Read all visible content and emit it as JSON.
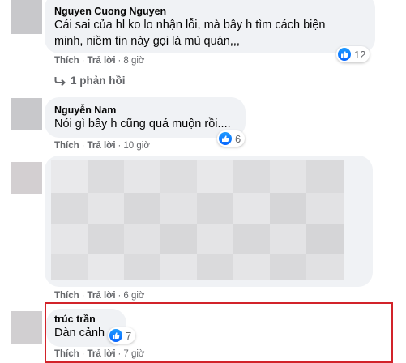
{
  "comments": [
    {
      "author": "Nguyen Cuong Nguyen",
      "text_line1": "Cái sai của hl ko lo nhận lỗi, mà bây h tìm cách biện",
      "text_line2": "minh, niềm tin này gọi là mù quán,,,",
      "like_label": "Thích",
      "reply_label": "Trả lời",
      "time": "8 giờ",
      "reaction_count": "12",
      "replies_label": "1 phản hồi"
    },
    {
      "author": "Nguyễn Nam",
      "text": "Nói gì bây h cũng quá muộn rồi....",
      "like_label": "Thích",
      "reply_label": "Trả lời",
      "time": "10 giờ",
      "reaction_count": "6"
    },
    {
      "like_label": "Thích",
      "reply_label": "Trả lời",
      "time": "6 giờ"
    },
    {
      "author": "trúc trần",
      "text": "Dàn cảnh",
      "like_label": "Thích",
      "reply_label": "Trả lời",
      "time": "7 giờ",
      "reaction_count": "7"
    }
  ],
  "icons": {
    "like": "thumbs-up-icon",
    "reply_arrow": "reply-arrow-icon"
  },
  "colors": {
    "bubble": "#f0f2f5",
    "like_blue": "#0866ff",
    "highlight_red": "#d2232a",
    "muted": "#65676b"
  }
}
